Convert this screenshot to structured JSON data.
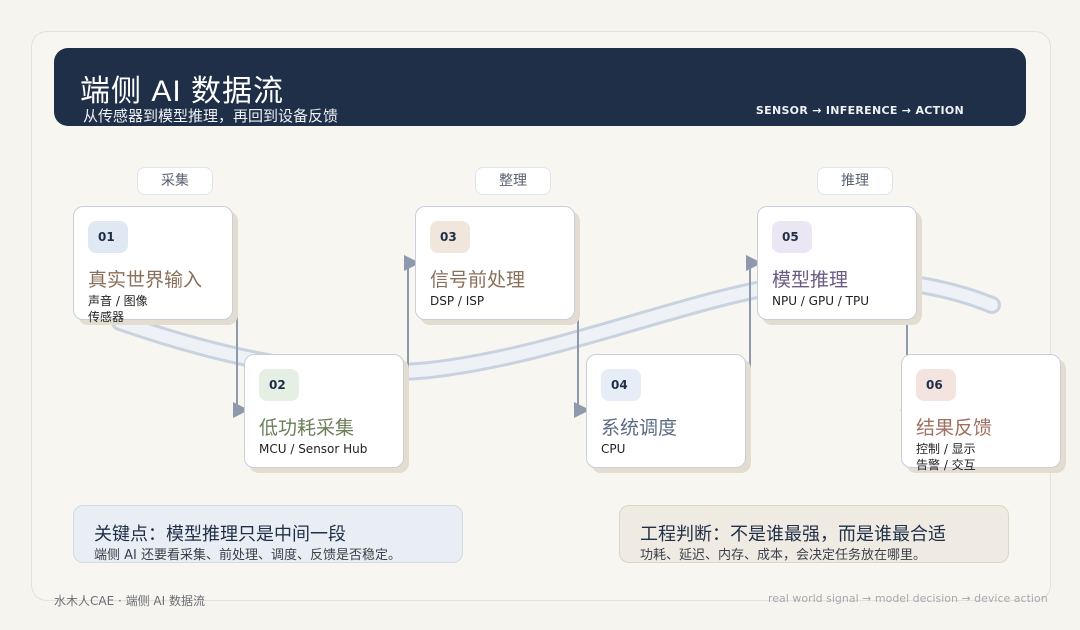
{
  "header": {
    "title": "端侧 AI 数据流",
    "subtitle": "从传感器到模型推理，再回到设备反馈",
    "tagline": "SENSOR → INFERENCE → ACTION"
  },
  "stages": [
    {
      "label": "采集"
    },
    {
      "label": "整理"
    },
    {
      "label": "推理"
    }
  ],
  "steps": [
    {
      "num": "01",
      "title": "真实世界输入",
      "detail": "声音 / 图像\n传感器",
      "title_color": "#8a6f5a",
      "badge_color": "#dfe8f3"
    },
    {
      "num": "02",
      "title": "低功耗采集",
      "detail": "MCU / Sensor Hub",
      "title_color": "#6b7f5a",
      "badge_color": "#e6efe3"
    },
    {
      "num": "03",
      "title": "信号前处理",
      "detail": "DSP / ISP",
      "title_color": "#8a6f5a",
      "badge_color": "#f0e6dc"
    },
    {
      "num": "04",
      "title": "系统调度",
      "detail": "CPU",
      "title_color": "#5b6a85",
      "badge_color": "#e6edf6"
    },
    {
      "num": "05",
      "title": "模型推理",
      "detail": "NPU / GPU / TPU",
      "title_color": "#6b5a85",
      "badge_color": "#ebe6f3"
    },
    {
      "num": "06",
      "title": "结果反馈",
      "detail": "控制 / 显示\n告警 / 交互",
      "title_color": "#a07060",
      "badge_color": "#f3e4df"
    }
  ],
  "notes": {
    "left": {
      "title": "关键点：模型推理只是中间一段",
      "body": "端侧 AI 还要看采集、前处理、调度、反馈是否稳定。"
    },
    "right": {
      "title": "工程判断：不是谁最强，而是谁最合适",
      "body": "功耗、延迟、内存、成本，会决定任务放在哪里。"
    }
  },
  "footer": {
    "left": "水木人CAE · 端侧 AI 数据流",
    "right": "real world signal → model decision → device action"
  },
  "colors": {
    "header_bg": "#1f2f48",
    "flow_ribbon": "#dfe6ef",
    "connector": "#8e9aac"
  }
}
